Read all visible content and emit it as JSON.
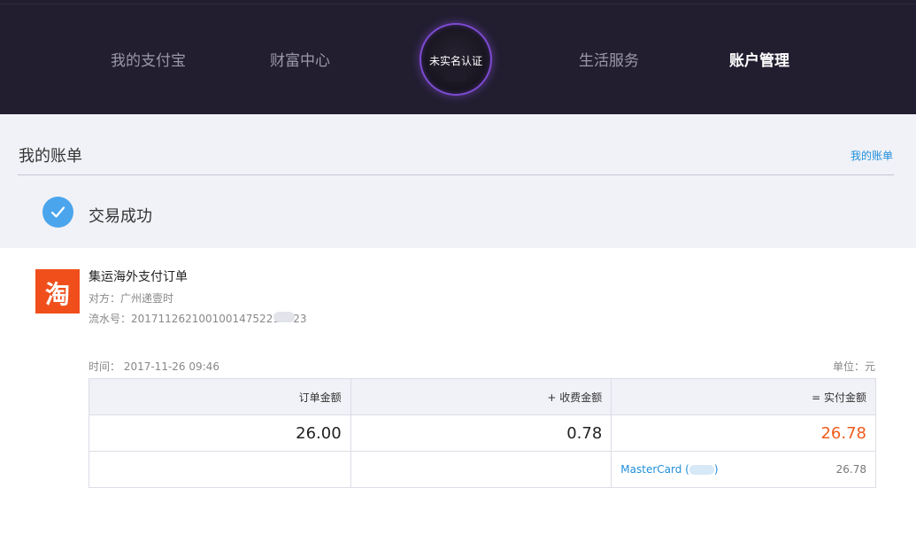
{
  "nav": {
    "items": [
      "我的支付宝",
      "财富中心",
      "生活服务",
      "账户管理"
    ],
    "avatar_label": "未实名认证"
  },
  "bill": {
    "title": "我的账单",
    "link": "我的账单",
    "status": "交易成功"
  },
  "order": {
    "logo_char": "淘",
    "title": "集运海外支付订单",
    "counterparty": "对方：广州递壹时",
    "serial": "流水号：20171126210010014752212823"
  },
  "meta": {
    "time": "时间：  2017-11-26 09:46",
    "unit": "单位：元"
  },
  "table": {
    "headers": [
      "订单金额",
      "+ 收费金额",
      "= 实付金额"
    ],
    "values": [
      "26.00",
      "0.78",
      "26.78"
    ],
    "payment": {
      "method_prefix": "MasterCard (",
      "method_suffix": ")",
      "amount": "26.78"
    }
  },
  "colors": {
    "nav_bg": "#221e30",
    "accent_blue": "#1f8fdb",
    "total_orange": "#f05c1c",
    "taobao_red": "#f04f1c"
  }
}
